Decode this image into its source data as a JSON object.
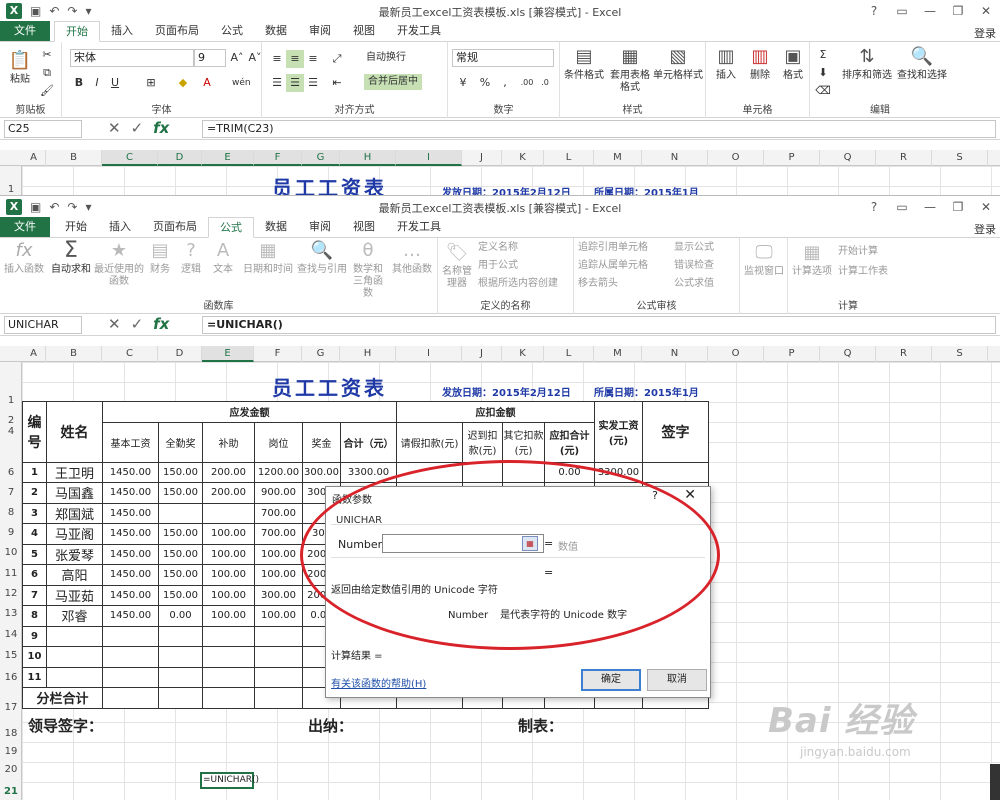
{
  "window": {
    "title": "最新员工excel工资表模板.xls  [兼容模式] - Excel",
    "login": "登录"
  },
  "tabs1": [
    "文件",
    "开始",
    "插入",
    "页面布局",
    "公式",
    "数据",
    "审阅",
    "视图",
    "开发工具"
  ],
  "tabs2": [
    "文件",
    "开始",
    "插入",
    "页面布局",
    "公式",
    "数据",
    "审阅",
    "视图",
    "开发工具"
  ],
  "home_ribbon": {
    "paste": "粘贴",
    "clipboard": "剪贴板",
    "font_name": "宋体",
    "font_size": "9",
    "font_group": "字体",
    "wrap_text": "自动换行",
    "merge_center": "合并后居中",
    "align_group": "对齐方式",
    "number_format": "常规",
    "number_group": "数字",
    "cond_format": "条件格式",
    "table_format": "套用表格格式",
    "cell_style": "单元格样式",
    "style_group": "样式",
    "insert": "插入",
    "delete": "删除",
    "format": "格式",
    "cells_group": "单元格",
    "sort_filter": "排序和筛选",
    "find_select": "查找和选择",
    "edit_group": "编辑",
    "bold": "B",
    "italic": "I",
    "underline": "U"
  },
  "formula_ribbon": {
    "insert_func": "插入函数",
    "autosum": "自动求和",
    "recent": "最近使用的函数",
    "financial": "财务",
    "logical": "逻辑",
    "text": "文本",
    "datetime": "日期和时间",
    "lookup": "查找与引用",
    "math": "数学和三角函数",
    "other": "其他函数",
    "library_group": "函数库",
    "name_mgr": "名称管理器",
    "define_name": "定义名称",
    "use_formula": "用于公式",
    "create_sel": "根据所选内容创建",
    "names_group": "定义的名称",
    "trace_prec": "追踪引用单元格",
    "trace_dep": "追踪从属单元格",
    "remove_arrows": "移去箭头",
    "show_formula": "显示公式",
    "error_check": "错误检查",
    "eval_formula": "公式求值",
    "watch": "监视窗口",
    "audit_group": "公式审核",
    "calc_options": "计算选项",
    "calc_now": "开始计算",
    "calc_sheet": "计算工作表",
    "calc_group": "计算"
  },
  "formula_bar1": {
    "name": "C25",
    "formula": "=TRIM(C23)"
  },
  "formula_bar2": {
    "name": "UNICHAR",
    "formula": "=UNICHAR()"
  },
  "columns": [
    "A",
    "B",
    "C",
    "D",
    "E",
    "F",
    "G",
    "H",
    "I",
    "J",
    "K",
    "L",
    "M",
    "N",
    "O",
    "P",
    "Q",
    "R",
    "S"
  ],
  "sheet": {
    "title": "员工工资表",
    "issue_date": "发放日期：2015年2月12日",
    "period": "所属日期：2015年1月",
    "rows_top": [
      "1"
    ],
    "rows": [
      "1",
      "2",
      "4",
      "6",
      "7",
      "8",
      "9",
      "10",
      "11",
      "12",
      "13",
      "14",
      "15",
      "16",
      "17",
      "18",
      "19",
      "20",
      "21"
    ],
    "h_no": "编号",
    "h_name": "姓名",
    "h_payable": "应发金额",
    "h_deduct": "应扣金额",
    "h_net": "实发工资(元)",
    "h_sign": "签字",
    "sub": [
      "基本工资",
      "全勤奖",
      "补助",
      "岗位",
      "奖金",
      "合计（元）",
      "请假扣款(元)",
      "迟到扣款(元)",
      "其它扣款(元)",
      "应扣合计(元)"
    ],
    "employees": [
      {
        "no": "1",
        "name": "王卫明",
        "base": "1450.00",
        "att": "150.00",
        "sub": "200.00",
        "post": "1200.00",
        "bonus": "300.00",
        "total": "3300.00",
        "leave": "",
        "late": "",
        "other": "",
        "ded": "0.00",
        "net": "3300.00"
      },
      {
        "no": "2",
        "name": "马国鑫",
        "base": "1450.00",
        "att": "150.00",
        "sub": "200.00",
        "post": "900.00",
        "bonus": "300.0",
        "total": "",
        "leave": "",
        "late": "",
        "other": "",
        "ded": "",
        "net": ""
      },
      {
        "no": "3",
        "name": "郑国斌",
        "base": "1450.00",
        "att": "",
        "sub": "",
        "post": "700.00",
        "bonus": "",
        "total": "",
        "leave": "",
        "late": "",
        "other": "",
        "ded": "",
        "net": ""
      },
      {
        "no": "4",
        "name": "马亚阁",
        "base": "1450.00",
        "att": "150.00",
        "sub": "100.00",
        "post": "700.00",
        "bonus": "300",
        "total": "",
        "leave": "",
        "late": "",
        "other": "",
        "ded": "",
        "net": ""
      },
      {
        "no": "5",
        "name": "张爱琴",
        "base": "1450.00",
        "att": "150.00",
        "sub": "100.00",
        "post": "100.00",
        "bonus": "200.0",
        "total": "",
        "leave": "",
        "late": "",
        "other": "",
        "ded": "",
        "net": ""
      },
      {
        "no": "6",
        "name": "高阳",
        "base": "1450.00",
        "att": "150.00",
        "sub": "100.00",
        "post": "100.00",
        "bonus": "200.0",
        "total": "",
        "leave": "",
        "late": "",
        "other": "",
        "ded": "",
        "net": ""
      },
      {
        "no": "7",
        "name": "马亚茹",
        "base": "1450.00",
        "att": "150.00",
        "sub": "100.00",
        "post": "300.00",
        "bonus": "200.0",
        "total": "",
        "leave": "",
        "late": "",
        "other": "",
        "ded": "",
        "net": ""
      },
      {
        "no": "8",
        "name": "邓睿",
        "base": "1450.00",
        "att": "0.00",
        "sub": "100.00",
        "post": "100.00",
        "bonus": "0.00",
        "total": "",
        "leave": "",
        "late": "",
        "other": "",
        "ded": "",
        "net": ""
      },
      {
        "no": "9",
        "name": "",
        "base": "",
        "att": "",
        "sub": "",
        "post": "",
        "bonus": "",
        "total": "",
        "leave": "",
        "late": "",
        "other": "",
        "ded": "",
        "net": ""
      },
      {
        "no": "10",
        "name": "",
        "base": "",
        "att": "",
        "sub": "",
        "post": "",
        "bonus": "",
        "total": "",
        "leave": "",
        "late": "",
        "other": "",
        "ded": "",
        "net": ""
      },
      {
        "no": "11",
        "name": "",
        "base": "",
        "att": "",
        "sub": "",
        "post": "",
        "bonus": "",
        "total": "",
        "leave": "",
        "late": "",
        "other": "",
        "ded": "",
        "net": ""
      }
    ],
    "subtotal": "分栏合计",
    "leader_sign": "领导签字：",
    "cashier": "出纳：",
    "preparer": "制表：",
    "active_cell": "=UNICHAR()"
  },
  "dialog": {
    "title": "函数参数",
    "help_q": "?",
    "close": "✕",
    "func": "UNICHAR",
    "arg_label": "Number",
    "eq": "=",
    "arg_hint": "数值",
    "desc": "返回由给定数值引用的 Unicode 字符",
    "arg_name": "Number",
    "arg_desc": "是代表字符的 Unicode 数字",
    "result": "计算结果 =",
    "help_link": "有关该函数的帮助(H)",
    "ok": "确定",
    "cancel": "取消"
  },
  "watermark": {
    "brand": "Bai 经验",
    "url": "jingyan.baidu.com"
  }
}
